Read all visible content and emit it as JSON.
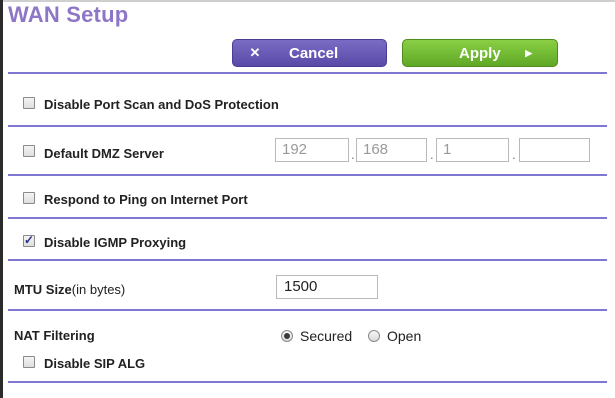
{
  "header": {
    "title": "WAN Setup"
  },
  "toolbar": {
    "cancel_label": "Cancel",
    "cancel_icon": "x-icon",
    "apply_label": "Apply",
    "apply_icon": "triangle-right-icon"
  },
  "options": {
    "port_scan": {
      "label": "Disable Port Scan and DoS Protection",
      "checked": false
    },
    "dmz": {
      "label": "Default DMZ Server",
      "checked": false,
      "ip": [
        "192",
        "168",
        "1",
        ""
      ],
      "separator": "."
    },
    "ping": {
      "label": "Respond to Ping on Internet Port",
      "checked": false
    },
    "igmp": {
      "label": "Disable IGMP Proxying",
      "checked": true
    }
  },
  "mtu": {
    "label": "MTU Size",
    "unit": "(in bytes)",
    "value": "1500"
  },
  "nat": {
    "label": "NAT Filtering",
    "options": [
      {
        "label": "Secured",
        "selected": true
      },
      {
        "label": "Open",
        "selected": false
      }
    ]
  },
  "sip": {
    "label": "Disable SIP ALG",
    "checked": false
  },
  "colors": {
    "title": "#8e76c7",
    "divider": "#7f78d0",
    "cancel": "#5a4aa8",
    "apply": "#5fa826"
  }
}
